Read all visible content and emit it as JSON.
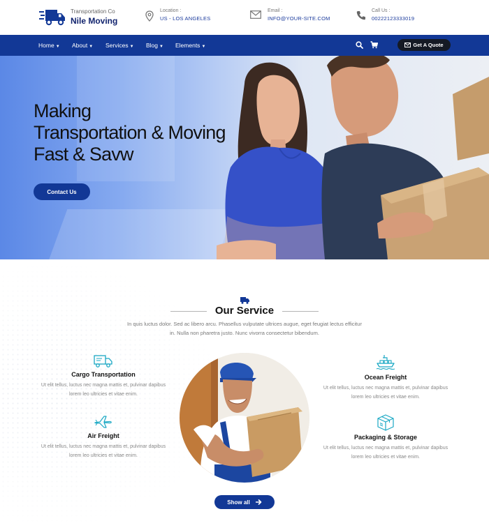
{
  "header": {
    "brand_small": "Transportation Co",
    "brand_name": "Nile Moving",
    "location_label": "Location :",
    "location_value": "US - LOS ANGELES",
    "email_label": "Email :",
    "email_value": "INFO@YOUR-SITE.COM",
    "call_label": "Call Us :",
    "call_value": "00222123333019"
  },
  "nav": {
    "items": [
      {
        "label": "Home"
      },
      {
        "label": "About"
      },
      {
        "label": "Services"
      },
      {
        "label": "Blog"
      },
      {
        "label": "Elements"
      }
    ],
    "quote_label": "Get A Quote"
  },
  "hero": {
    "title_line1": "Making",
    "title_line2": "Transportation & Moving",
    "title_line3": "Fast & Savw",
    "button_label": "Contact Us"
  },
  "services": {
    "title": "Our Service",
    "description": "In quis luctus dolor. Sed ac libero arcu. Phasellus vulputate ultrices augue, eget feugiat lectus efficitur in. Nulla non pharetra justo. Nunc vivorra consectetur bibendum.",
    "items": [
      {
        "name": "Cargo Transportation",
        "text": "Ut elit tellus, luctus nec magna mattis et, pulvinar dapibus lorem leo ultricies et vitae enim."
      },
      {
        "name": "Air Freight",
        "text": "Ut elit tellus, luctus nec magna mattis et, pulvinar dapibus lorem leo ultricies et vitae enim."
      },
      {
        "name": "Ocean Freight",
        "text": "Ut elit tellus, luctus nec magna mattis et, pulvinar dapibus lorem leo ultricies et vitae enim."
      },
      {
        "name": "Packaging & Storage",
        "text": "Ut elit tellus, luctus nec magna mattis et, pulvinar dapibus lorem leo ultricies et vitae enim."
      }
    ],
    "show_all_label": "Show all"
  },
  "icons": {
    "logo": "truck-icon",
    "location": "map-pin-icon",
    "email": "envelope-icon",
    "call": "phone-icon",
    "search": "search-icon",
    "cart": "cart-icon",
    "quote": "envelope-icon",
    "section": "truck-icon",
    "cargo": "truck-icon",
    "air": "airplane-icon",
    "ocean": "ship-icon",
    "packaging": "box-icon",
    "show_all": "arrow-right-icon"
  },
  "colors": {
    "primary": "#123896",
    "accent_teal": "#1aa8c4",
    "dark_button": "#151a24",
    "heading": "#111111"
  }
}
